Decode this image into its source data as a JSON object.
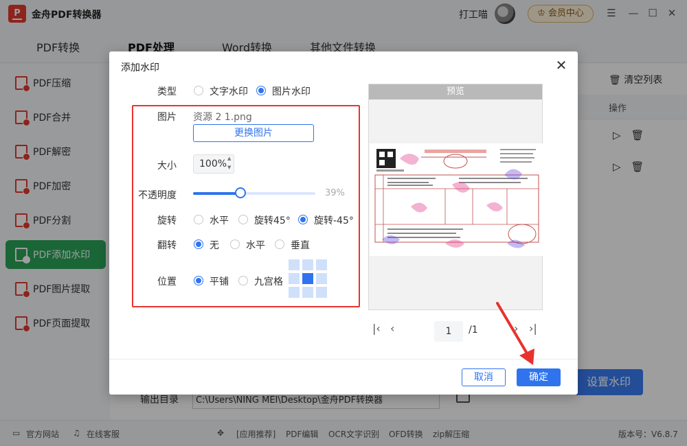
{
  "app": {
    "name": "金舟PDF转换器",
    "logo_text": "P",
    "user_name": "打工喵",
    "member_label": "会员中心"
  },
  "top_tabs": [
    "PDF转换",
    "PDF处理",
    "Word转换",
    "其他文件转换"
  ],
  "sidebar": {
    "items": [
      "PDF压缩",
      "PDF合并",
      "PDF解密",
      "PDF加密",
      "PDF分割",
      "PDF添加水印",
      "PDF图片提取",
      "PDF页面提取"
    ]
  },
  "content": {
    "clear_list": "清空列表",
    "action_column": "操作",
    "set_watermark_button": "设置水印",
    "output_dir_label": "输出目录",
    "output_dir_value": "C:\\Users\\NING MEI\\Desktop\\金舟PDF转换器"
  },
  "statusbar": {
    "official_site": "官方网站",
    "online_support": "在线客服",
    "app_recommend": "[应用推荐]",
    "links": [
      "PDF编辑",
      "OCR文字识别",
      "OFD转换",
      "zip解压缩"
    ],
    "version": "版本号：V6.8.7"
  },
  "dialog": {
    "title": "添加水印",
    "type_label": "类型",
    "type_options": [
      "文字水印",
      "图片水印"
    ],
    "type_selected": "图片水印",
    "image_label": "图片",
    "image_file": "资源 2 1.png",
    "change_image_button": "更换图片",
    "size_label": "大小",
    "size_value": "100%",
    "opacity_label": "不透明度",
    "opacity_value": "39%",
    "opacity_fraction": 0.39,
    "rotate_label": "旋转",
    "rotate_options": [
      "水平",
      "旋转45°",
      "旋转-45°"
    ],
    "rotate_selected": "旋转-45°",
    "flip_label": "翻转",
    "flip_options": [
      "无",
      "水平",
      "垂直"
    ],
    "flip_selected": "无",
    "position_label": "位置",
    "position_options": [
      "平铺",
      "九宫格"
    ],
    "position_selected": "平铺",
    "nine_grid_selected": "center",
    "preview_title": "预览",
    "page_current": "1",
    "page_total": "/1",
    "cancel_button": "取消",
    "ok_button": "确定"
  },
  "colors": {
    "accent": "#2f74ee",
    "sidebar_active": "#2aa55a",
    "highlight_frame": "#e8322d",
    "logo": "#e43a2f"
  }
}
